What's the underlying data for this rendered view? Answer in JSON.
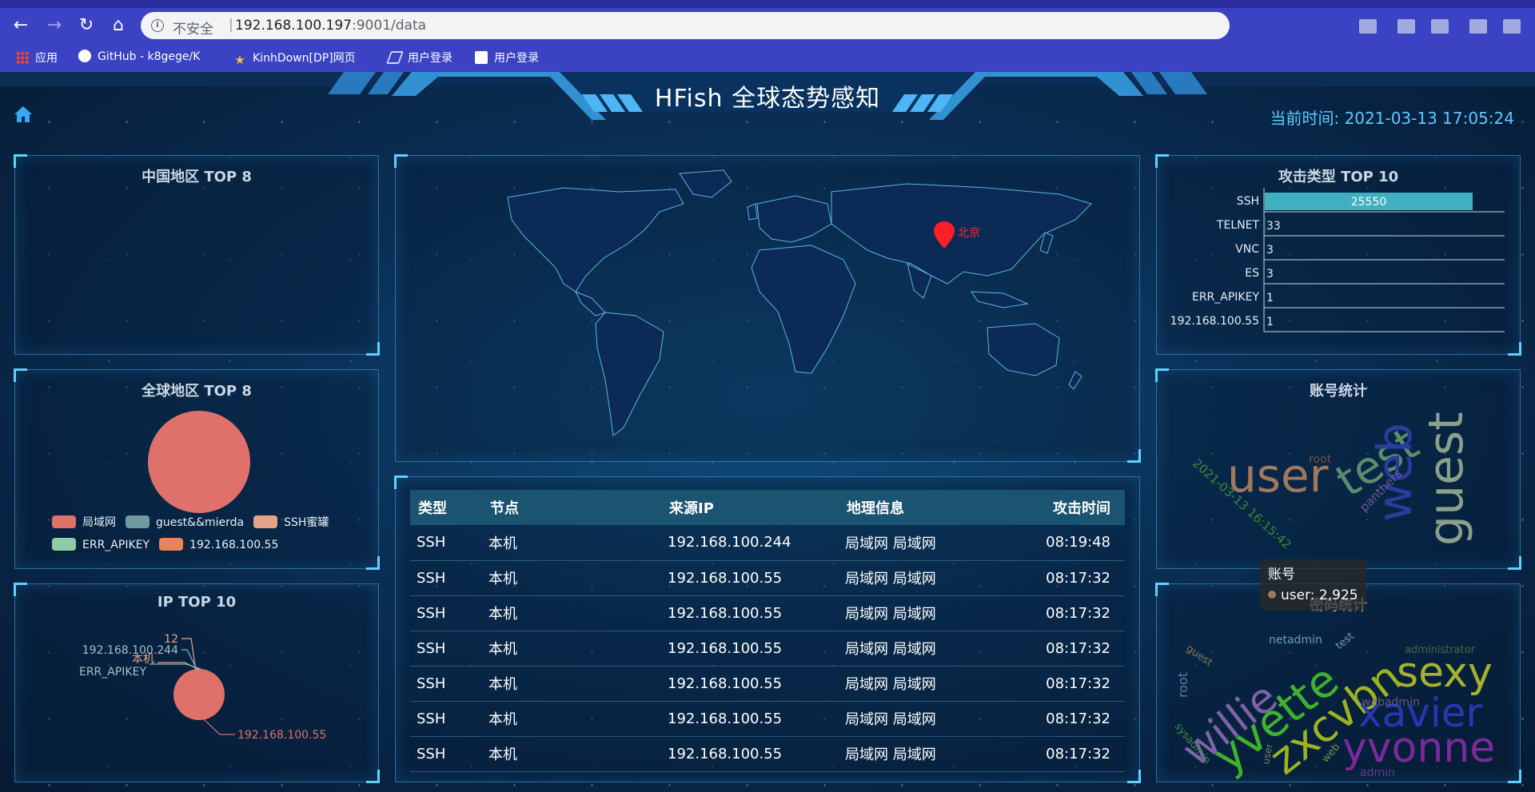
{
  "browser": {
    "insecure_label": "不安全",
    "separator": "|",
    "url_host": "192.168.100.197",
    "url_port_path": ":9001/data",
    "bookmarks": [
      {
        "label": "应用",
        "icon": "apps-grid-icon"
      },
      {
        "label": "GitHub - k8gege/K",
        "icon": "github-icon"
      },
      {
        "label": "KinhDown[DP]网页",
        "icon": "kinhdown-icon"
      },
      {
        "label": "用户登录",
        "icon": "login-page-icon"
      },
      {
        "label": "用户登录",
        "icon": "login-user-icon"
      }
    ]
  },
  "dashboard": {
    "title": "HFish 全球态势感知",
    "clock": "当前时间: 2021-03-13 17:05:24",
    "panels": {
      "china_top": "中国地区 TOP 8",
      "global_top": "全球地区 TOP 8",
      "ip_top": "IP TOP 10",
      "attack_type": "攻击类型 TOP 10",
      "account_stats": "账号统计",
      "password_stats": "密码统计"
    },
    "map_marker_label": "北京"
  },
  "table": {
    "headers": [
      "类型",
      "节点",
      "来源IP",
      "地理信息",
      "攻击时间"
    ],
    "rows": [
      [
        "SSH",
        "本机",
        "192.168.100.244",
        "局域网 局域网",
        "08:19:48"
      ],
      [
        "SSH",
        "本机",
        "192.168.100.55",
        "局域网 局域网",
        "08:17:32"
      ],
      [
        "SSH",
        "本机",
        "192.168.100.55",
        "局域网 局域网",
        "08:17:32"
      ],
      [
        "SSH",
        "本机",
        "192.168.100.55",
        "局域网 局域网",
        "08:17:32"
      ],
      [
        "SSH",
        "本机",
        "192.168.100.55",
        "局域网 局域网",
        "08:17:32"
      ],
      [
        "SSH",
        "本机",
        "192.168.100.55",
        "局域网 局域网",
        "08:17:32"
      ],
      [
        "SSH",
        "本机",
        "192.168.100.55",
        "局域网 局域网",
        "08:17:32"
      ]
    ]
  },
  "global_pie": {
    "legend": [
      {
        "name": "局域网",
        "color": "#e0706a"
      },
      {
        "name": "guest&&mierda",
        "color": "#6e9aa0"
      },
      {
        "name": "SSH蜜罐",
        "color": "#e7a38a"
      },
      {
        "name": "ERR_APIKEY",
        "color": "#8ecda8"
      },
      {
        "name": "192.168.100.55",
        "color": "#e98458"
      }
    ]
  },
  "ip_pie": {
    "labels": [
      "12",
      "192.168.100.244",
      "本机",
      "ERR_APIKEY",
      "192.168.100.55"
    ],
    "colors": [
      "#e0706a",
      "#6e9aa0",
      "#e7a38a",
      "#6e9aa0",
      "#e0706a"
    ]
  },
  "chart_data": [
    {
      "type": "bar",
      "title": "攻击类型 TOP 10",
      "categories": [
        "SSH",
        "TELNET",
        "VNC",
        "ES",
        "ERR_APIKEY",
        "192.168.100.55"
      ],
      "values": [
        25550,
        33,
        3,
        3,
        1,
        1
      ],
      "bar_color": "#3fb0c0"
    }
  ],
  "account_cloud": {
    "words": [
      "user",
      "test",
      "web",
      "guest",
      "root",
      "2021-03-13 16:15:42",
      "panthers"
    ],
    "tooltip_title": "账号",
    "tooltip_value": "user: 2,925"
  },
  "password_cloud": {
    "words": [
      "willie",
      "yvette",
      "zxcvbn",
      "sexy",
      "xavier",
      "yvonne",
      "netadmin",
      "test",
      "guest",
      "root",
      "sysadmin",
      "user",
      "web",
      "webadmin",
      "admin",
      "administrator"
    ]
  }
}
